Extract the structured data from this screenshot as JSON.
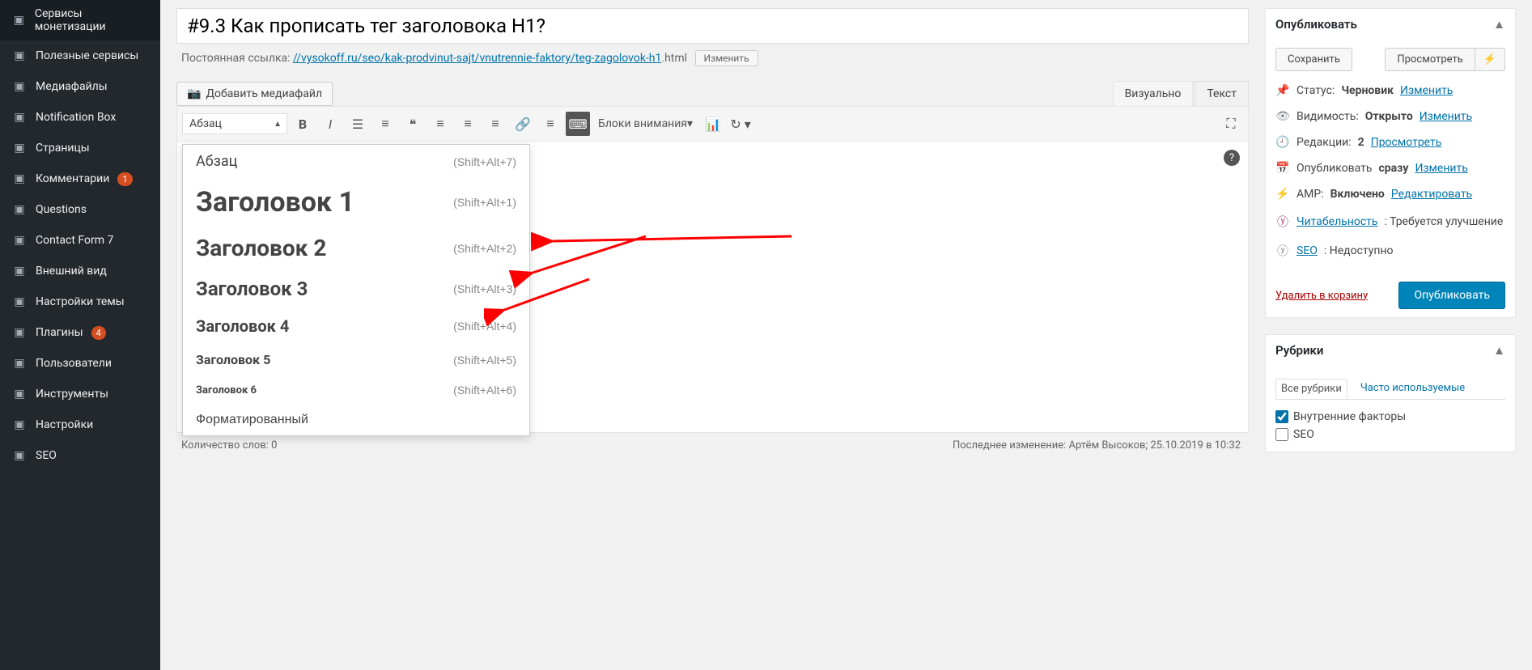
{
  "sidebar": {
    "items": [
      {
        "label": "Сервисы монетизации",
        "icon": "grid"
      },
      {
        "label": "Полезные сервисы",
        "icon": "list"
      },
      {
        "label": "Медиафайлы",
        "icon": "media"
      },
      {
        "label": "Notification Box",
        "icon": "box"
      },
      {
        "label": "Страницы",
        "icon": "page"
      },
      {
        "label": "Комментарии",
        "icon": "comment",
        "badge": "1"
      },
      {
        "label": "Questions",
        "icon": "help"
      },
      {
        "label": "Contact Form 7",
        "icon": "mail"
      },
      {
        "label": "Внешний вид",
        "icon": "brush"
      },
      {
        "label": "Настройки темы",
        "icon": "gear"
      },
      {
        "label": "Плагины",
        "icon": "plugin",
        "badge": "4"
      },
      {
        "label": "Пользователи",
        "icon": "user"
      },
      {
        "label": "Инструменты",
        "icon": "wrench"
      },
      {
        "label": "Настройки",
        "icon": "settings"
      },
      {
        "label": "SEO",
        "icon": "seo"
      }
    ]
  },
  "editor": {
    "title": "#9.3 Как прописать тег заголовока H1?",
    "permalink_label": "Постоянная ссылка:",
    "permalink_prefix": "//vysokoff.ru/seo/kak-prodvinut-sajt/vnutrennie-faktory/",
    "permalink_slug": "teg-zagolovok-h1",
    "permalink_ext": ".html",
    "permalink_edit": "Изменить",
    "add_media": "Добавить медиафайл",
    "tabs": {
      "visual": "Визуально",
      "text": "Текст"
    },
    "format_selected": "Абзац",
    "attention_label": "Блоки внимания",
    "format_options": [
      {
        "label": "Абзац",
        "shortcut": "(Shift+Alt+7)",
        "cls": "para"
      },
      {
        "label": "Заголовок 1",
        "shortcut": "(Shift+Alt+1)",
        "cls": "h1"
      },
      {
        "label": "Заголовок 2",
        "shortcut": "(Shift+Alt+2)",
        "cls": "h2"
      },
      {
        "label": "Заголовок 3",
        "shortcut": "(Shift+Alt+3)",
        "cls": "h3"
      },
      {
        "label": "Заголовок 4",
        "shortcut": "(Shift+Alt+4)",
        "cls": "h4"
      },
      {
        "label": "Заголовок 5",
        "shortcut": "(Shift+Alt+5)",
        "cls": "h5"
      },
      {
        "label": "Заголовок 6",
        "shortcut": "(Shift+Alt+6)",
        "cls": "h6"
      },
      {
        "label": "Форматированный",
        "shortcut": "",
        "cls": "pre"
      }
    ],
    "word_count_label": "Количество слов: 0",
    "last_edit_label": "Последнее изменение: Артём Высоков; 25.10.2019 в 10:32"
  },
  "publish": {
    "header": "Опубликовать",
    "save": "Сохранить",
    "preview": "Просмотреть",
    "status_label": "Статус:",
    "status_value": "Черновик",
    "edit": "Изменить",
    "visibility_label": "Видимость:",
    "visibility_value": "Открыто",
    "revisions_label": "Редакции:",
    "revisions_value": "2",
    "revisions_browse": "Просмотреть",
    "publish_label": "Опубликовать",
    "publish_value": "сразу",
    "amp_label": "AMP:",
    "amp_value": "Включено",
    "amp_edit": "Редактировать",
    "readability": "Читабельность",
    "readability_value": ": Требуется улучшение",
    "seo": "SEO",
    "seo_value": ": Недоступно",
    "trash": "Удалить в корзину",
    "publish_btn": "Опубликовать"
  },
  "categories": {
    "header": "Рубрики",
    "tab_all": "Все рубрики",
    "tab_freq": "Часто используемые",
    "items": [
      {
        "label": "Внутренние факторы",
        "checked": true
      },
      {
        "label": "SEO",
        "checked": false
      }
    ]
  }
}
